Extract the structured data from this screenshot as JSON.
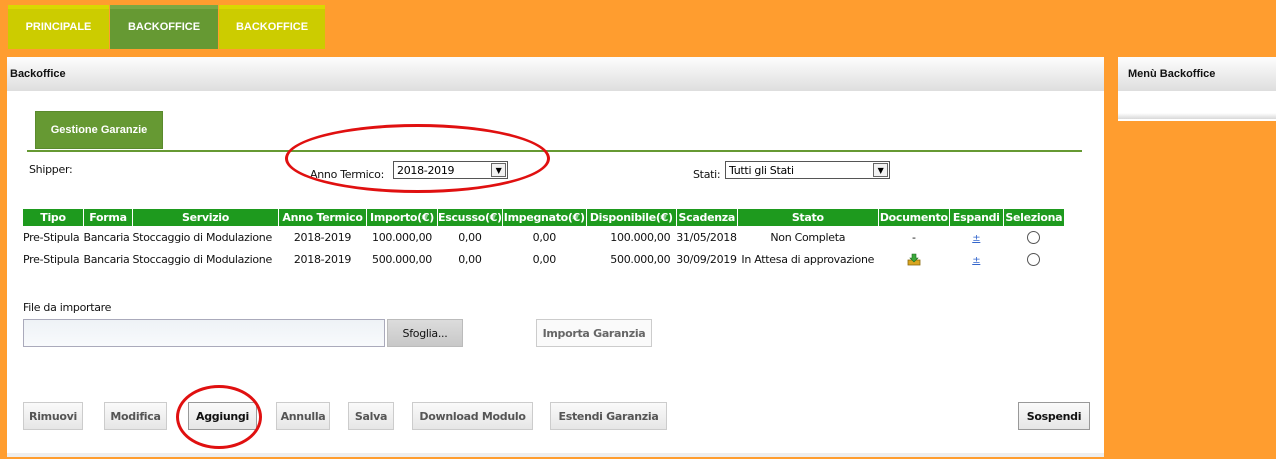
{
  "nav": {
    "tabs": [
      "PRINCIPALE",
      "BACKOFFICE",
      "BACKOFFICE"
    ]
  },
  "main": {
    "title": "Backoffice"
  },
  "side": {
    "title": "Menù Backoffice"
  },
  "section_tab": "Gestione Garanzie",
  "filters": {
    "shipper_label": "Shipper:",
    "anno_label": "Anno Termico:",
    "anno_value": "2018-2019",
    "stati_label": "Stati:",
    "stati_value": "Tutti gli Stati"
  },
  "table": {
    "headers": [
      "Tipo",
      "Forma",
      "Servizio",
      "Anno Termico",
      "Importo(€)",
      "Escusso(€)",
      "Impegnato(€)",
      "Disponibile(€)",
      "Scadenza",
      "Stato",
      "Documento",
      "Espandi",
      "Seleziona"
    ],
    "rows": [
      {
        "tipo": "Pre-Stipula",
        "forma": "Bancaria",
        "servizio": "Stoccaggio di Modulazione",
        "anno": "2018-2019",
        "importo": "100.000,00",
        "escusso": "0,00",
        "impegnato": "0,00",
        "disponibile": "100.000,00",
        "scadenza": "31/05/2018",
        "stato": "Non Completa",
        "documento": "-",
        "espandi": "±"
      },
      {
        "tipo": "Pre-Stipula",
        "forma": "Bancaria",
        "servizio": "Stoccaggio di Modulazione",
        "anno": "2018-2019",
        "importo": "500.000,00",
        "escusso": "0,00",
        "impegnato": "0,00",
        "disponibile": "500.000,00",
        "scadenza": "30/09/2019",
        "stato": "In Attesa di approvazione",
        "documento": "",
        "espandi": "±"
      }
    ]
  },
  "file": {
    "label": "File da importare",
    "browse": "Sfoglia...",
    "import": "Importa Garanzia"
  },
  "actions": {
    "rimuovi": "Rimuovi",
    "modifica": "Modifica",
    "aggiungi": "Aggiungi",
    "annulla": "Annulla",
    "salva": "Salva",
    "download": "Download Modulo",
    "estendi": "Estendi Garanzia",
    "sospendi": "Sospendi"
  },
  "colors": {
    "orange": "#ff9d2f",
    "green": "#669933",
    "yellow": "#cccc00",
    "table_header": "#1e9a1e",
    "annotation": "#e01010"
  },
  "icons": [
    "download-document-icon",
    "dropdown-arrow-icon"
  ]
}
